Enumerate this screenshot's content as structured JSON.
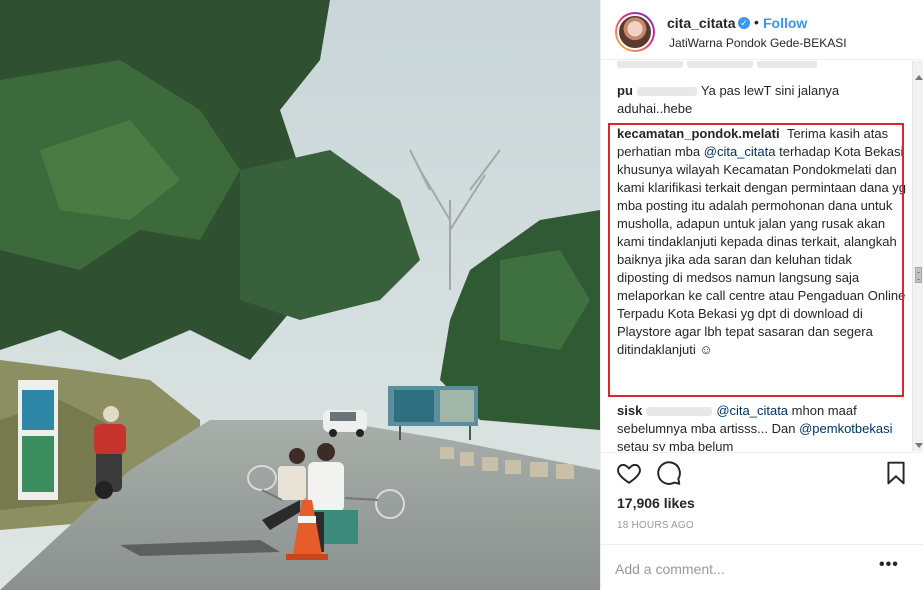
{
  "post": {
    "username": "cita_citata",
    "follow_label": "Follow",
    "separator": "•",
    "location": "JatiWarna Pondok Gede-BEKASI"
  },
  "comments": [
    {
      "username": "",
      "text": ""
    },
    {
      "username": "pu",
      "text": "Ya pas lewT sini jalanya aduhai..hebe"
    },
    {
      "username": "kecamatan_pondok.melati",
      "text_before": "Terima kasih atas perhatian mba",
      "mention": "@cita_citata",
      "text_after": "terhadap Kota Bekasi khusunya wilayah Kecamatan Pondokmelati dan kami klarifikasi terkait dengan permintaan dana yg mba posting itu adalah permohonan dana untuk musholla, adapun untuk jalan yang rusak akan kami tindaklanjuti kepada dinas terkait, alangkah baiknya jika ada saran dan keluhan tidak diposting di medsos namun langsung saja melaporkan ke call centre atau Pengaduan Online Terpadu Kota Bekasi yg dpt di download di Playstore agar lbh tepat sasaran dan segera ditindaklanjuti ☺"
    },
    {
      "username": "sisk",
      "mention": "@cita_citata",
      "text_before": "mhon maaf sebelumnya mba artisss... Dan",
      "mention2": "@pemkotbekasi",
      "text_after": "setau sy mba belum"
    }
  ],
  "actions": {
    "likes": "17,906 likes",
    "timestamp": "18 HOURS AGO",
    "add_comment_placeholder": "Add a comment...",
    "more_label": "•••"
  },
  "icons": {
    "like": "heart-outline-icon",
    "comment": "speech-bubble-icon",
    "save": "bookmark-outline-icon",
    "verified": "verified-badge-icon",
    "more": "ellipsis-icon"
  },
  "colors": {
    "link_blue": "#3897f0",
    "mention_blue": "#003569",
    "highlight_red": "#d9272e",
    "muted_gray": "#999999"
  }
}
